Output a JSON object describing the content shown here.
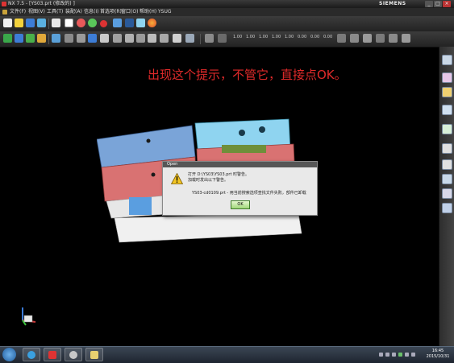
{
  "window": {
    "title": "NX 7.5 - [YS03.prt  (修改的) ]",
    "brand": "SIEMENS",
    "minimize": "_",
    "maximize": "□",
    "close": "×"
  },
  "menu": {
    "items": [
      "文件(F)",
      "视图(V)",
      "工具(T)",
      "装配(A)",
      "信息(I)",
      "首选项(R)",
      "窗口(O)",
      "帮助(H)",
      "YSUG"
    ]
  },
  "toolbar": {
    "numbers": [
      "1.00",
      "1.00",
      "1.00",
      "1.00",
      "1.00",
      "0.00",
      "0.00",
      "0.00"
    ]
  },
  "annotation": "出现这个提示，不管它，直接点OK。",
  "dialog": {
    "title": "Open",
    "line1": "打开 D:\\YS03\\YS03.prt 时警告。",
    "line2": "加载时发出以下警告。",
    "line3": "YS03-cd0109.prt - 用当前搜索选项查找文件失败，部件已卸载",
    "ok_label": "OK"
  },
  "taskbar": {
    "time": "16:45",
    "date": "2015/10/31"
  },
  "colors": {
    "annotation": "#e02a2a",
    "mold_blue": "#7aa4d8",
    "mold_red": "#d97272",
    "mold_cyan": "#8fd4f0",
    "ok_green": "#9fd67a"
  }
}
